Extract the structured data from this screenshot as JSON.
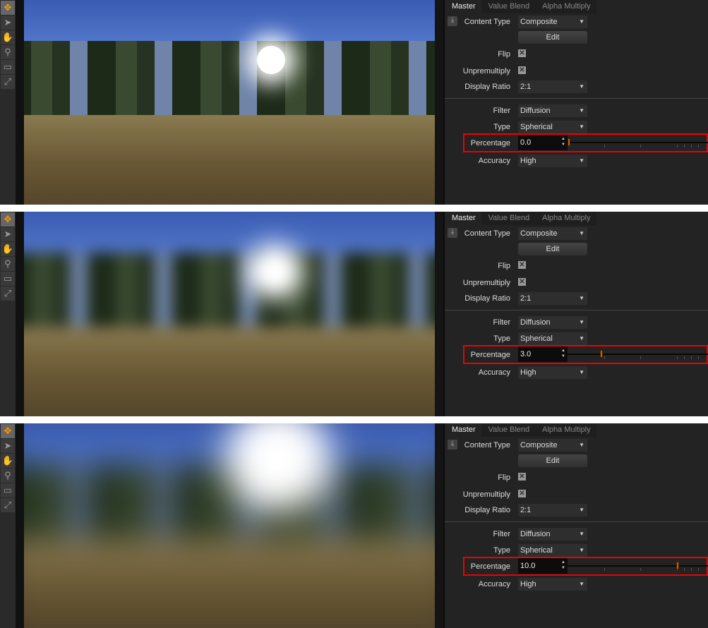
{
  "tools": [
    {
      "icon": "move-icon",
      "glyph": "✥"
    },
    {
      "icon": "pointer-icon",
      "glyph": "➤"
    },
    {
      "icon": "hand-icon",
      "glyph": "✋"
    },
    {
      "icon": "zoom-icon",
      "glyph": "⚲"
    },
    {
      "icon": "zoom-region-icon",
      "glyph": "▭"
    },
    {
      "icon": "zoom-fit-icon",
      "glyph": "⤢"
    }
  ],
  "tabs": [
    "Master",
    "Value Blend",
    "Alpha Multiply"
  ],
  "labels": {
    "content_type": "Content Type",
    "edit": "Edit",
    "flip": "Flip",
    "unpremultiply": "Unpremultiply",
    "display_ratio": "Display Ratio",
    "filter": "Filter",
    "type": "Type",
    "percentage": "Percentage",
    "accuracy": "Accuracy"
  },
  "slider_range": [
    0,
    10
  ],
  "accent_color": "#c8600c",
  "highlight_color": "#e00000",
  "panes": [
    {
      "content_type": "Composite",
      "flip": true,
      "unpremultiply": true,
      "display_ratio": "2:1",
      "filter": "Diffusion",
      "type": "Spherical",
      "percentage": "0.0",
      "percentage_value": 0,
      "accuracy": "High"
    },
    {
      "content_type": "Composite",
      "flip": true,
      "unpremultiply": true,
      "display_ratio": "2:1",
      "filter": "Diffusion",
      "type": "Spherical",
      "percentage": "3.0",
      "percentage_value": 3,
      "accuracy": "High"
    },
    {
      "content_type": "Composite",
      "flip": true,
      "unpremultiply": true,
      "display_ratio": "2:1",
      "filter": "Diffusion",
      "type": "Spherical",
      "percentage": "10.0",
      "percentage_value": 10,
      "accuracy": "High"
    }
  ]
}
